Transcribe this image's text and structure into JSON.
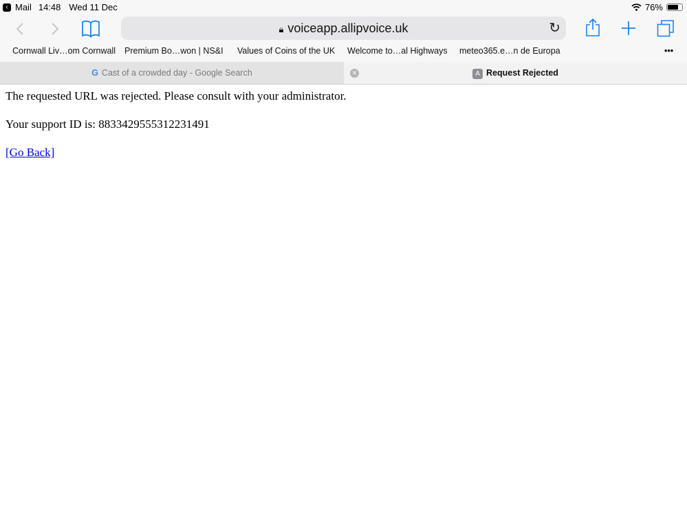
{
  "status_bar": {
    "back_app": "Mail",
    "time": "14:48",
    "date": "Wed 11 Dec",
    "battery": "76%",
    "battery_level": 0.76
  },
  "toolbar": {
    "url": "voiceapp.allipvoice.uk",
    "icons": [
      "chevron-left-icon",
      "chevron-right-icon",
      "bookmarks-book-icon",
      "lock-icon",
      "reload-icon",
      "share-icon",
      "plus-icon",
      "tabs-icon"
    ],
    "accent": "#1a82fb"
  },
  "bookmarks": [
    "Cornwall Liv…om Cornwall",
    "Premium Bo…won | NS&I",
    "Values of Coins of the UK",
    "Welcome to…al Highways",
    "meteo365.e…n de Europa"
  ],
  "more": "•••",
  "tabs": [
    {
      "label": "Cast of a crowded day - Google Search",
      "favicon": "G"
    },
    {
      "label": "Request Rejected",
      "favicon": "A",
      "active": true
    }
  ],
  "page": {
    "message": "The requested URL was rejected. Please consult with your administrator.",
    "support_id": "Your support ID is: 8833429555312231491",
    "go_back": "[Go Back]"
  }
}
